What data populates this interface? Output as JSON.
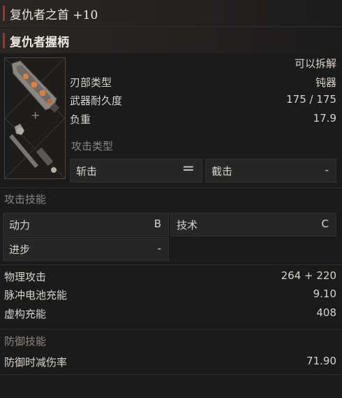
{
  "header": {
    "title": "复仇者之首 +10"
  },
  "subheader": {
    "title": "复仇者握柄"
  },
  "weapon": {
    "dismantle": "可以拆解",
    "stats": [
      {
        "label": "刃部类型",
        "value": "钝器"
      },
      {
        "label": "武器耐久度",
        "value": "175 / 175"
      },
      {
        "label": "负重",
        "value": "17.9"
      }
    ],
    "plus_sign": "+"
  },
  "attack_type": {
    "heading": "攻击类型",
    "left_label": "斩击",
    "equals": "=",
    "right_label": "截击",
    "right_value": "-"
  },
  "attack_skills": {
    "heading": "攻击技能",
    "items": [
      {
        "label": "动力",
        "value": "B"
      },
      {
        "label": "技术",
        "value": "C"
      },
      {
        "label": "进步",
        "value": "-"
      }
    ]
  },
  "attack_stats": [
    {
      "label": "物理攻击",
      "value": "264 + 220"
    },
    {
      "label": "脉冲电池充能",
      "value": "9.10"
    },
    {
      "label": "虚构充能",
      "value": "408"
    }
  ],
  "defense": {
    "heading": "防御技能",
    "label": "防御时减伤率",
    "value": "71.90"
  },
  "colors": {
    "accent": "#8a3b33",
    "glow": "#e0803a",
    "panel": "#262626"
  }
}
